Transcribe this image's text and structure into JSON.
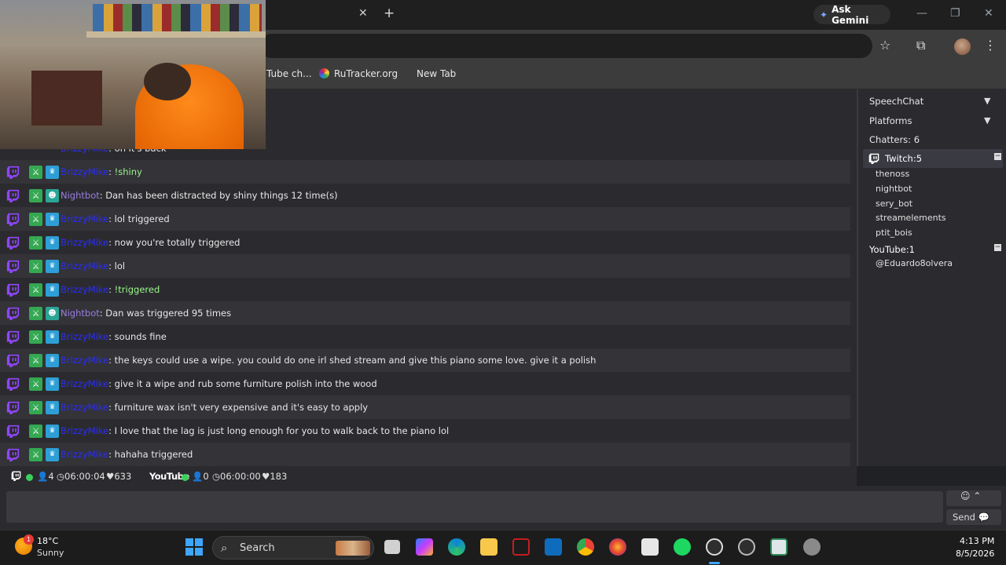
{
  "browser": {
    "gemini_label": "Ask Gemini",
    "bookmarks": [
      "Tube ch...",
      "RuTracker.org",
      "New Tab"
    ]
  },
  "chat": {
    "partial_message": "oh it's back",
    "messages": [
      {
        "user": "BrizzyMike",
        "text": "!shiny",
        "command": true,
        "bot": false
      },
      {
        "user": "Nightbot",
        "text": "Dan has been distracted by shiny things 12 time(s)",
        "command": false,
        "bot": true
      },
      {
        "user": "BrizzyMike",
        "text": "lol triggered",
        "command": false,
        "bot": false
      },
      {
        "user": "BrizzyMike",
        "text": "now you're totally triggered",
        "command": false,
        "bot": false
      },
      {
        "user": "BrizzyMike",
        "text": "lol",
        "command": false,
        "bot": false
      },
      {
        "user": "BrizzyMike",
        "text": "!triggered",
        "command": true,
        "bot": false
      },
      {
        "user": "Nightbot",
        "text": "Dan was triggered 95 times",
        "command": false,
        "bot": true
      },
      {
        "user": "BrizzyMike",
        "text": "sounds fine",
        "command": false,
        "bot": false
      },
      {
        "user": "BrizzyMike",
        "text": "the keys could use a wipe. you could do one irl shed stream and give this piano some love. give it a polish",
        "command": false,
        "bot": false
      },
      {
        "user": "BrizzyMike",
        "text": "give it a wipe and rub some furniture polish into the wood",
        "command": false,
        "bot": false
      },
      {
        "user": "BrizzyMike",
        "text": "furniture wax isn't very expensive and it's easy to apply",
        "command": false,
        "bot": false
      },
      {
        "user": "BrizzyMike",
        "text": "I love that the lag is just long enough for you to walk back to the piano lol",
        "command": false,
        "bot": false
      },
      {
        "user": "BrizzyMike",
        "text": "hahaha triggered",
        "command": false,
        "bot": false
      }
    ]
  },
  "status": {
    "twitch_viewers": "4",
    "twitch_uptime": "06:00:04",
    "twitch_likes": "633",
    "youtube_label": "YouTube",
    "youtube_viewers": "0",
    "youtube_uptime": "06:00:00",
    "youtube_likes": "183"
  },
  "composer": {
    "send_label": "Send"
  },
  "sidebar": {
    "speechchat": "SpeechChat",
    "platforms": "Platforms",
    "chatters": "Chatters: 6",
    "twitch_group": "Twitch:5",
    "twitch_users": [
      "thenoss",
      "nightbot",
      "sery_bot",
      "streamelements",
      "ptit_bois"
    ],
    "youtube_group": "YouTube:1",
    "youtube_users": [
      "@Eduardo8olvera"
    ]
  },
  "taskbar": {
    "temperature": "18°C",
    "condition": "Sunny",
    "weather_badge": "1",
    "search_label": "Search",
    "time": "4:13 PM",
    "date": "8/5/2026"
  },
  "colors": {
    "twitch_purple": "#9146ff",
    "username_blue": "#2a2cff",
    "nightbot_purple": "#9b7de0",
    "command_green": "#9af78a"
  }
}
